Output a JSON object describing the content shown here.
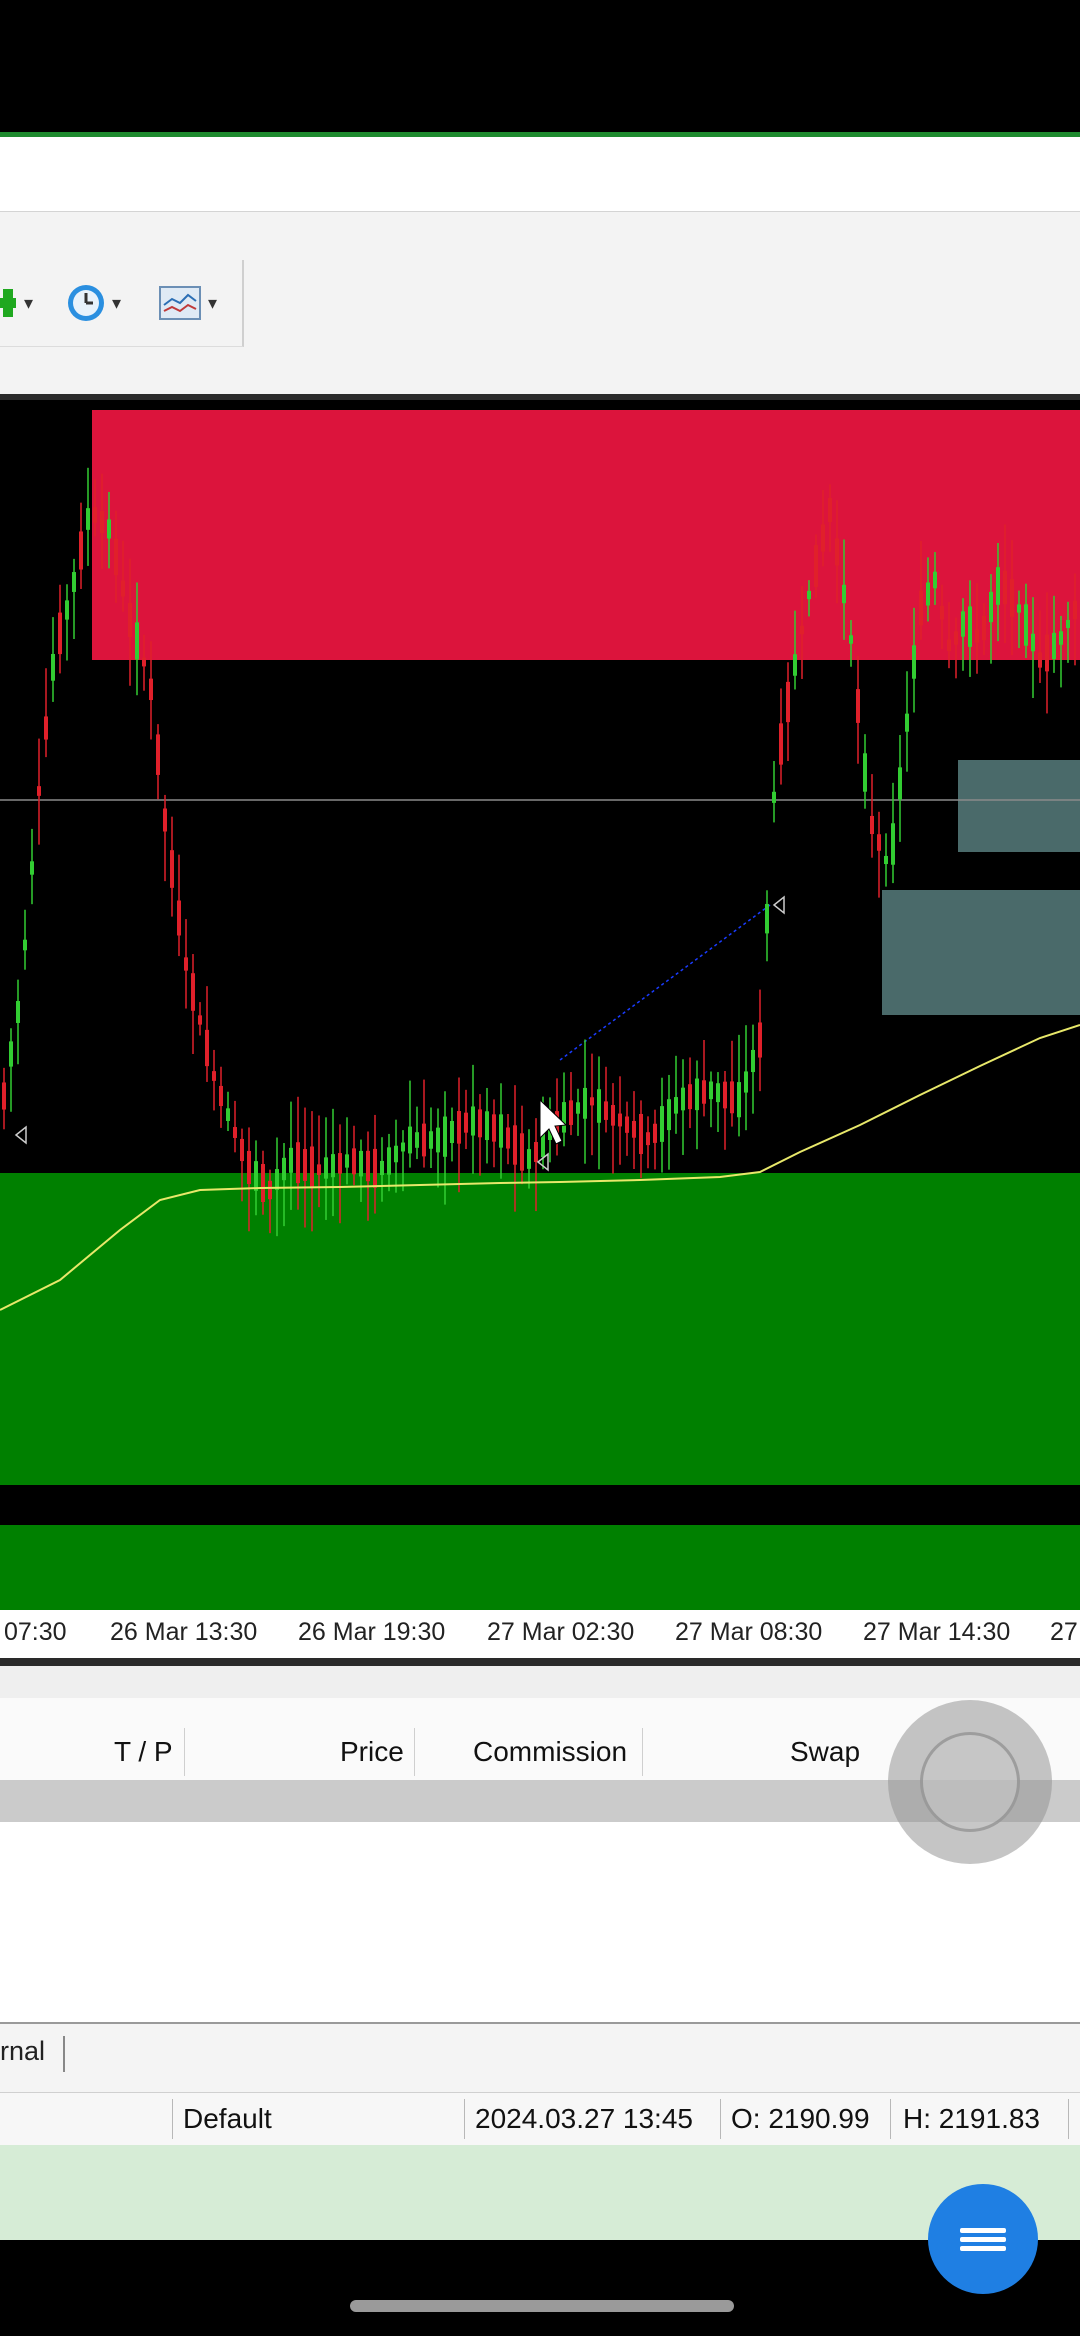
{
  "toolbar": {
    "buttons": [
      {
        "name": "new-order",
        "icon": "green-plus-icon"
      },
      {
        "name": "period",
        "icon": "clock-icon"
      },
      {
        "name": "indicators",
        "icon": "indicator-chart-icon"
      }
    ]
  },
  "chart": {
    "time_labels": [
      "07:30",
      "26 Mar 13:30",
      "26 Mar 19:30",
      "27 Mar 02:30",
      "27 Mar 08:30",
      "27 Mar 14:30",
      "27"
    ],
    "colors": {
      "background": "#000000",
      "supply_zone": "#dc143c",
      "demand_zone": "#008000",
      "bull_candle": "#32cd32",
      "bear_candle": "#e0202a",
      "moving_average": "#e8e86a",
      "grey_box": "#4a6a6a"
    }
  },
  "table": {
    "columns": [
      "T / P",
      "Price",
      "Commission",
      "Swap"
    ]
  },
  "tabs": {
    "journal_label": "rnal"
  },
  "status": {
    "profile": "Default",
    "datetime": "2024.03.27 13:45",
    "open": "O: 2190.99",
    "high": "H: 2191.83"
  }
}
